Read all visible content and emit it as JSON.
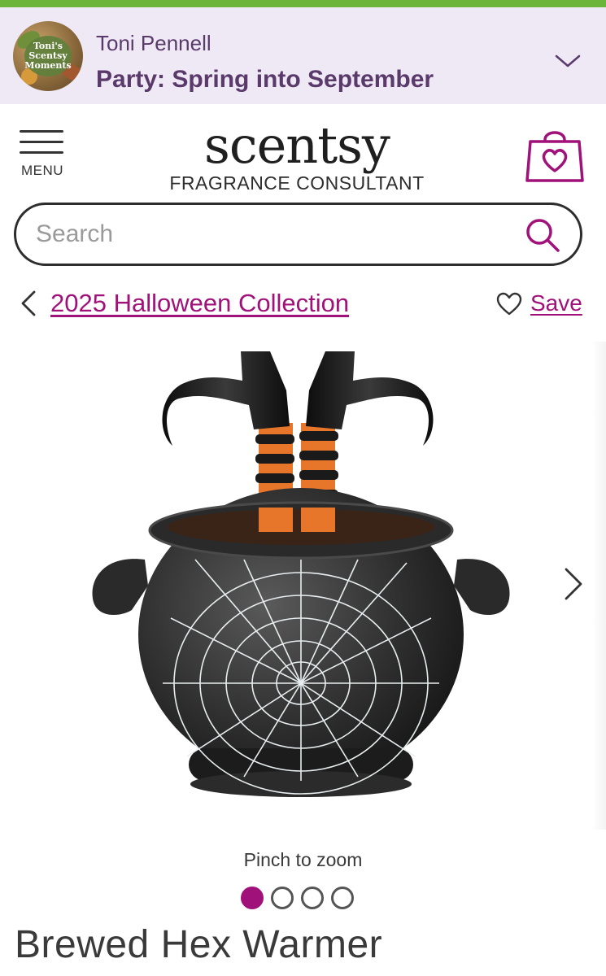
{
  "colors": {
    "accent": "#a0117a",
    "party_bg": "#efe9f5",
    "party_text": "#5a3a6b",
    "top_stripe": "#6bb53a"
  },
  "party": {
    "avatar_text": [
      "Toni's",
      "Scentsy",
      "Moments"
    ],
    "consultant_name": "Toni Pennell",
    "party_title": "Party: Spring into September",
    "dropdown_icon": "chevron-down-icon"
  },
  "header": {
    "menu_label": "MENU",
    "logo": "scentsy",
    "logo_subtitle": "FRAGRANCE CONSULTANT",
    "cart_icon": "shopping-bag-heart-icon"
  },
  "search": {
    "placeholder": "Search",
    "value": "",
    "icon": "search-icon"
  },
  "breadcrumb": {
    "back_icon": "chevron-left-icon",
    "label": "2025 Halloween Collection"
  },
  "save": {
    "icon": "heart-outline-icon",
    "label": "Save"
  },
  "gallery": {
    "image_alt": "Brewed Hex Warmer cauldron with witch legs",
    "next_icon": "chevron-right-icon",
    "zoom_hint": "Pinch to zoom",
    "total_images": 4,
    "active_index": 0
  },
  "product": {
    "title": "Brewed Hex Warmer"
  }
}
